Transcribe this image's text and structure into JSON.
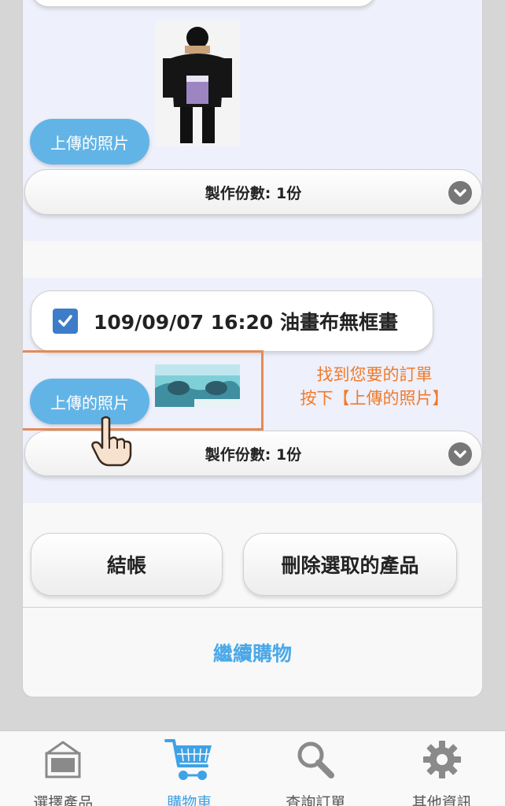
{
  "items": [
    {
      "upload_label": "上傳的照片",
      "quantity_label": "製作份數: 1份"
    },
    {
      "checked": true,
      "order_title": "109/09/07 16:20 油畫布無框畫",
      "upload_label": "上傳的照片",
      "quantity_label": "製作份數: 1份"
    }
  ],
  "annotation": {
    "line1": "找到您要的訂單",
    "line2": "按下【上傳的照片】"
  },
  "actions": {
    "checkout_label": "結帳",
    "delete_label": "刪除選取的產品"
  },
  "continue_label": "繼續購物",
  "tabbar": {
    "tabs": [
      {
        "label": "選擇產品",
        "icon": "frame-icon",
        "active": false
      },
      {
        "label": "購物車",
        "icon": "cart-icon",
        "active": true
      },
      {
        "label": "查詢訂單",
        "icon": "magnifier-icon",
        "active": false
      },
      {
        "label": "其他資訊",
        "icon": "gear-icon",
        "active": false
      }
    ]
  },
  "colors": {
    "accent": "#3fa2e6",
    "upload_button": "#63b4e6",
    "annotation": "#f07a2b",
    "checkbox": "#3d7cc8"
  }
}
